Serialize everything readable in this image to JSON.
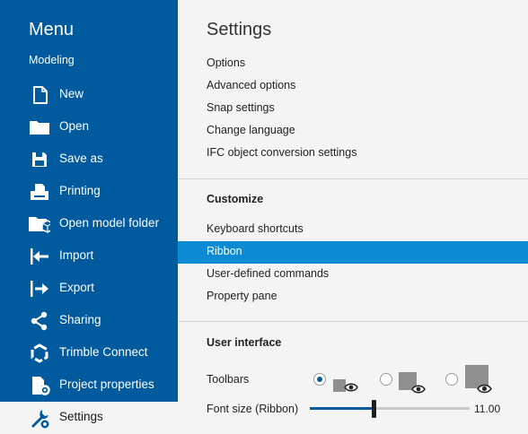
{
  "sidebar": {
    "title": "Menu",
    "subtitle": "Modeling",
    "items": [
      {
        "label": "New",
        "icon": "new-file-icon"
      },
      {
        "label": "Open",
        "icon": "folder-icon"
      },
      {
        "label": "Save as",
        "icon": "save-icon"
      },
      {
        "label": "Printing",
        "icon": "printer-icon"
      },
      {
        "label": "Open model folder",
        "icon": "model-folder-icon"
      },
      {
        "label": "Import",
        "icon": "import-icon"
      },
      {
        "label": "Export",
        "icon": "export-icon"
      },
      {
        "label": "Sharing",
        "icon": "share-icon"
      },
      {
        "label": "Trimble Connect",
        "icon": "trimble-connect-icon"
      },
      {
        "label": "Project properties",
        "icon": "project-properties-icon"
      },
      {
        "label": "Settings",
        "icon": "settings-wrench-icon",
        "active": true
      }
    ]
  },
  "main": {
    "title": "Settings",
    "settings_links": [
      "Options",
      "Advanced options",
      "Snap settings",
      "Change language",
      "IFC object conversion settings"
    ],
    "customize": {
      "title": "Customize",
      "links": [
        "Keyboard shortcuts",
        "Ribbon",
        "User-defined commands",
        "Property pane"
      ],
      "selected": "Ribbon"
    },
    "user_interface": {
      "title": "User interface",
      "toolbars_label": "Toolbars",
      "toolbar_size_options": [
        "small",
        "medium",
        "large"
      ],
      "toolbar_size_selected": "small",
      "font_size_label": "Font size (Ribbon)",
      "font_size_value": "11.00",
      "font_size_fraction": 0.4
    }
  },
  "colors": {
    "sidebar_bg": "#005a9e",
    "selected_bg": "#0c8bd4",
    "page_bg": "#f4f4f4"
  }
}
